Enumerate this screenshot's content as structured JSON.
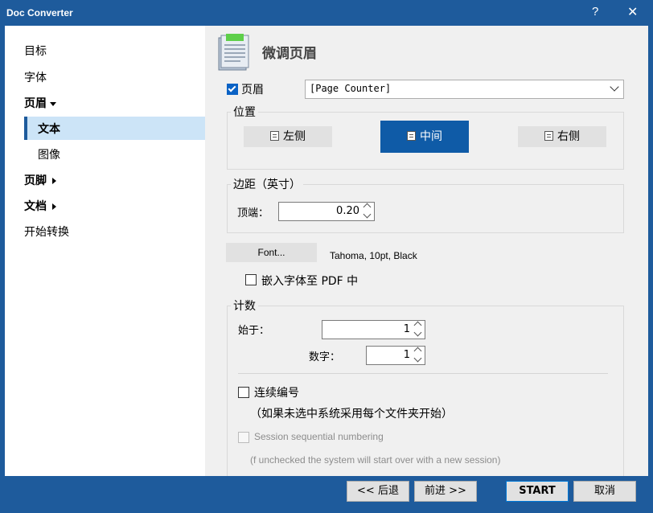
{
  "window": {
    "title": "Doc Converter",
    "help": "?",
    "close": "✕"
  },
  "sidebar": {
    "items": [
      {
        "label": "目标"
      },
      {
        "label": "字体"
      },
      {
        "label": "页眉"
      },
      {
        "label": "文本"
      },
      {
        "label": "图像"
      },
      {
        "label": "页脚"
      },
      {
        "label": "文档"
      },
      {
        "label": "开始转换"
      }
    ],
    "selected": "文本"
  },
  "main": {
    "page_title": "微调页眉",
    "header_checkbox": {
      "label": "页眉",
      "checked": true
    },
    "header_select": {
      "value": "[Page Counter]"
    },
    "position": {
      "label": "位置",
      "left": "左侧",
      "center": "中间",
      "right": "右侧",
      "selected": "中间"
    },
    "margin": {
      "label": "边距（英寸）",
      "top_label": "顶端：",
      "top_value": "0.20"
    },
    "font": {
      "button": "Font...",
      "description": "Tahoma, 10pt, Black",
      "embed_label": "嵌入字体至 PDF 中",
      "embed_checked": false
    },
    "counter": {
      "label": "计数",
      "start_label": "始于：",
      "start_value": "1",
      "digits_label": "数字：",
      "digits_value": "1",
      "continuous_label": "连续编号",
      "continuous_note": "（如果未选中系统采用每个文件夹开始）",
      "session_label": "Session sequential numbering",
      "session_note": "(f unchecked the system will start over with a new session)"
    }
  },
  "footer": {
    "back": "<< 后退",
    "next": "前进 >>",
    "start": "START",
    "cancel": "取消"
  },
  "colors": {
    "accent": "#1e5b9c",
    "selected_button": "#0f5ba7",
    "sidebar_selection": "#cce4f7"
  }
}
